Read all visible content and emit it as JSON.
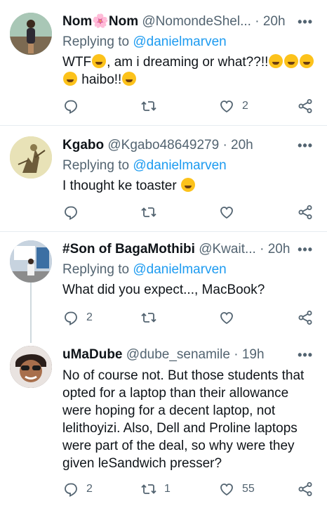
{
  "tweets": [
    {
      "name": "Nom🌸Nom",
      "handle": "@NomondeShel...",
      "time": "20h",
      "reply_prefix": "Replying to ",
      "reply_mention": "@danielmarven",
      "text_parts": [
        "WTF",
        ", am i dreaming or what??!!",
        "",
        "",
        "haibo!!",
        ""
      ],
      "reply_count": "",
      "retweet_count": "",
      "like_count": "2",
      "avatar_color": "#8fb3a2"
    },
    {
      "name": "Kgabo",
      "handle": "@Kgabo48649279",
      "time": "20h",
      "reply_prefix": "Replying to ",
      "reply_mention": "@danielmarven",
      "text": "I thought ke toaster",
      "reply_count": "",
      "retweet_count": "",
      "like_count": "",
      "avatar_color": "#d9d5a6"
    },
    {
      "name": "#Son of BagaMothibi",
      "handle": "@Kwait...",
      "time": "20h",
      "reply_prefix": "Replying to ",
      "reply_mention": "@danielmarven",
      "text": "What did you expect..., MacBook?",
      "reply_count": "2",
      "retweet_count": "",
      "like_count": "",
      "avatar_color": "#9ab0c8"
    },
    {
      "name": "uMaDube",
      "handle": "@dube_senamile",
      "time": "19h",
      "text": "No of course not. But those students that opted for a laptop than their allowance were hoping for a decent laptop, not lelithoyizi. Also, Dell and Proline laptops were part of the deal, so why were they given leSandwich presser?",
      "reply_count": "2",
      "retweet_count": "1",
      "like_count": "55",
      "avatar_color": "#5b4a43"
    }
  ],
  "more_label": "•••",
  "dot": "·",
  "colors": {
    "accent": "#1d9bf0",
    "muted": "#536471",
    "divider": "#e6ecf0"
  },
  "icons": [
    "reply-icon",
    "retweet-icon",
    "like-icon",
    "share-icon",
    "more-icon"
  ]
}
